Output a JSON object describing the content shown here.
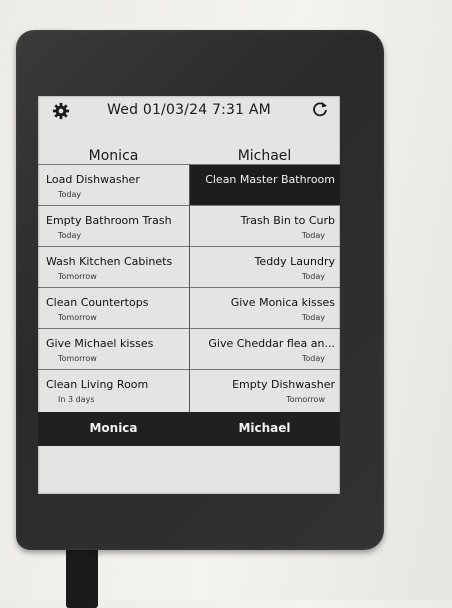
{
  "header": {
    "datetime": "Wed 01/03/24 7:31 AM",
    "settings_icon": "gear-icon",
    "refresh_icon": "refresh-icon"
  },
  "columns": {
    "left_name": "Monica",
    "right_name": "Michael"
  },
  "monica_tasks": [
    {
      "task": "Load Dishwasher",
      "when": "Today"
    },
    {
      "task": "Empty Bathroom Trash",
      "when": "Today"
    },
    {
      "task": "Wash Kitchen Cabinets",
      "when": "Tomorrow"
    },
    {
      "task": "Clean Countertops",
      "when": "Tomorrow"
    },
    {
      "task": "Give Michael kisses",
      "when": "Tomorrow"
    },
    {
      "task": "Clean Living Room",
      "when": "In 3 days"
    }
  ],
  "michael_tasks": [
    {
      "task": "Clean Master Bathroom",
      "when": ""
    },
    {
      "task": "Trash Bin to Curb",
      "when": "Today"
    },
    {
      "task": "Teddy Laundry",
      "when": "Today"
    },
    {
      "task": "Give Monica kisses",
      "when": "Today"
    },
    {
      "task": "Give Cheddar flea an...",
      "when": "Today"
    },
    {
      "task": "Empty Dishwasher",
      "when": "Tomorrow"
    }
  ],
  "bottom_tabs": {
    "left": "Monica",
    "right": "Michael"
  },
  "colors": {
    "screen": "#e4e5e2",
    "ink": "#1d1d1d",
    "bezel": "#2e2e2e"
  }
}
